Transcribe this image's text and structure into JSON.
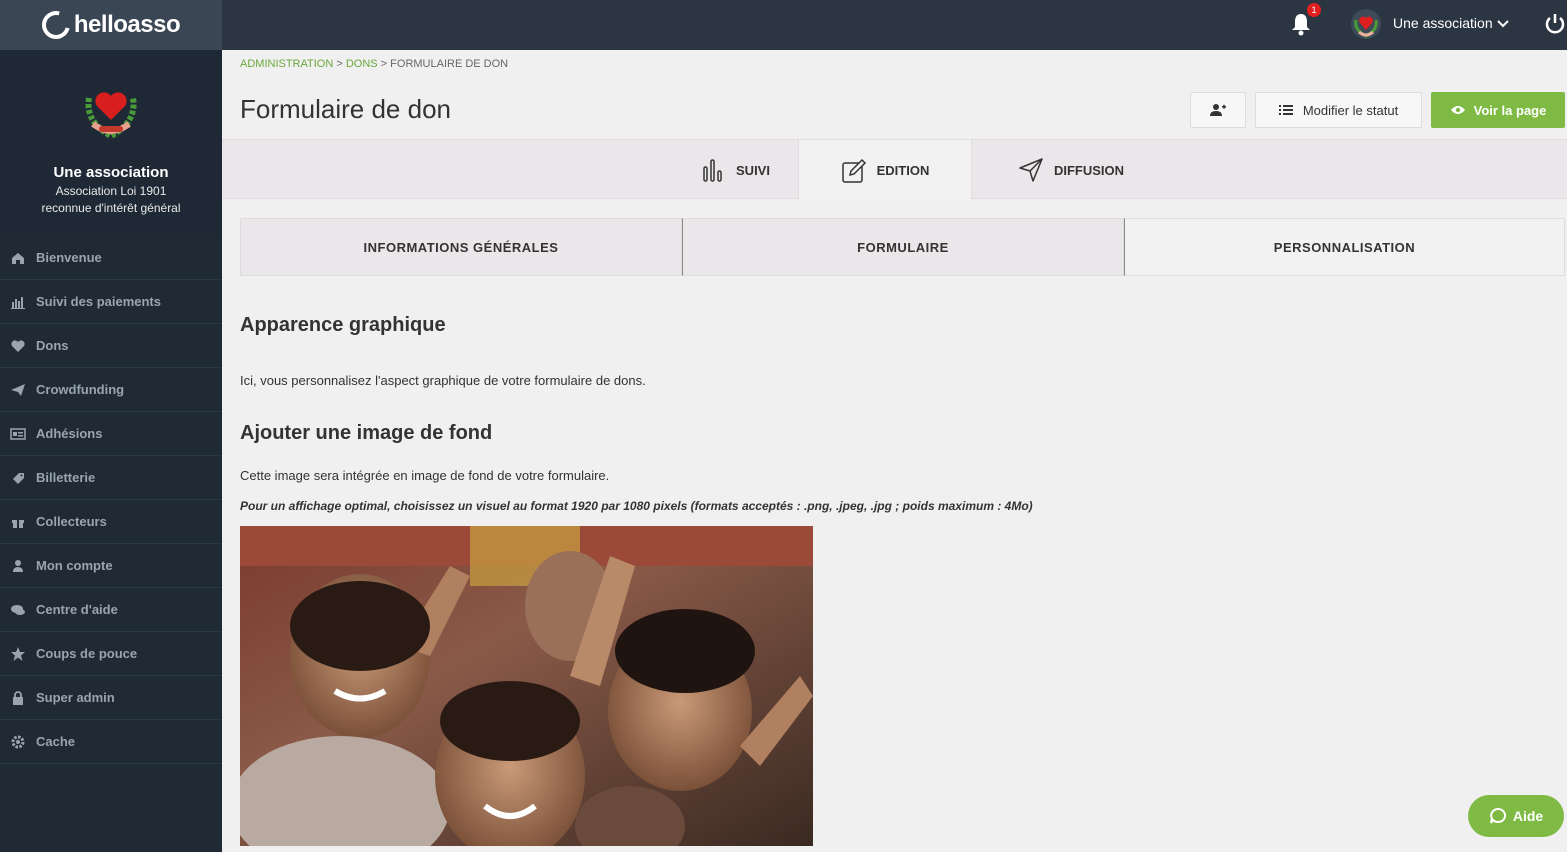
{
  "brand": {
    "name": "helloasso"
  },
  "topbar": {
    "notification_count": "1",
    "user_name": "Une association"
  },
  "org": {
    "name": "Une association",
    "subtitle_line1": "Association Loi 1901",
    "subtitle_line2": "reconnue d'intérêt général"
  },
  "sidebar": {
    "items": [
      {
        "label": "Bienvenue",
        "icon": "home-icon"
      },
      {
        "label": "Suivi des paiements",
        "icon": "bar-chart-icon"
      },
      {
        "label": "Dons",
        "icon": "heart-icon"
      },
      {
        "label": "Crowdfunding",
        "icon": "paper-plane-icon"
      },
      {
        "label": "Adhésions",
        "icon": "id-card-icon"
      },
      {
        "label": "Billetterie",
        "icon": "ticket-icon"
      },
      {
        "label": "Collecteurs",
        "icon": "gift-icon"
      },
      {
        "label": "Mon compte",
        "icon": "user-icon"
      },
      {
        "label": "Centre d'aide",
        "icon": "chat-icon"
      },
      {
        "label": "Coups de pouce",
        "icon": "star-icon"
      },
      {
        "label": "Super admin",
        "icon": "lock-icon"
      },
      {
        "label": "Cache",
        "icon": "gear-icon"
      }
    ]
  },
  "breadcrumb": {
    "item1": "ADMINISTRATION",
    "sep1": " > ",
    "item2": "DONS",
    "sep2": " > ",
    "item3": "FORMULAIRE DE DON"
  },
  "page": {
    "title": "Formulaire de don",
    "modify_status_label": "Modifier le statut",
    "view_page_label": "Voir la page"
  },
  "tabs": {
    "suivi": "SUIVI",
    "edition": "EDITION",
    "diffusion": "DIFFUSION"
  },
  "subtabs": {
    "general": "INFORMATIONS GÉNÉRALES",
    "form": "FORMULAIRE",
    "custom": "PERSONNALISATION"
  },
  "content": {
    "section1_title": "Apparence graphique",
    "section1_text": "Ici, vous personnalisez l'aspect graphique de votre formulaire de dons.",
    "section2_title": "Ajouter une image de fond",
    "section2_text": "Cette image sera intégrée en image de fond de votre formulaire.",
    "section2_note": "Pour un affichage optimal, choisissez un visuel au format 1920 par 1080 pixels (formats acceptés : .png, .jpeg, .jpg ; poids maximum : 4Mo)"
  },
  "help": {
    "label": "Aide"
  },
  "colors": {
    "accent_green": "#7fbb44",
    "topbar": "#2c3542",
    "sidebar": "#1f2a35"
  }
}
